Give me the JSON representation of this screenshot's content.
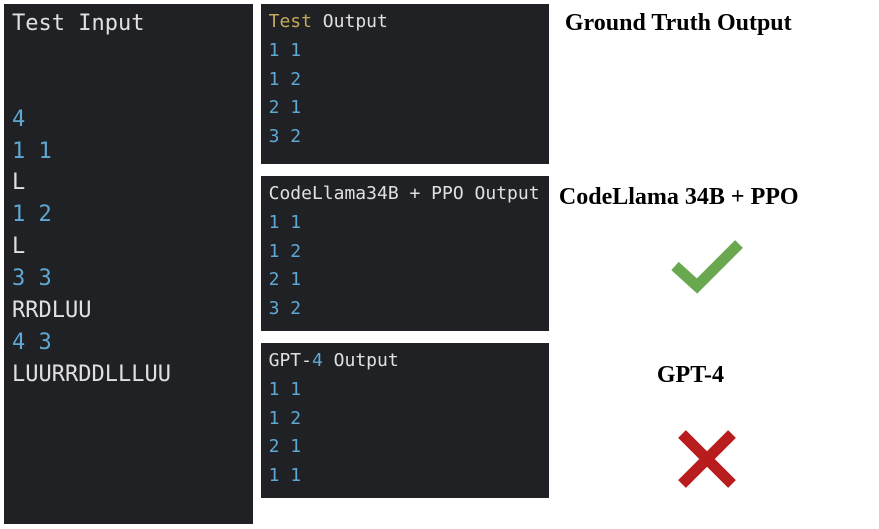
{
  "left_panel": {
    "title_parts": [
      {
        "text": "Test",
        "cls": "t-white"
      },
      {
        "text": " Input",
        "cls": "t-white"
      }
    ],
    "lines": [
      [
        {
          "text": "",
          "cls": "t-white"
        }
      ],
      [
        {
          "text": "",
          "cls": "t-white"
        }
      ],
      [
        {
          "text": "4",
          "cls": "t-cyan"
        }
      ],
      [
        {
          "text": "1 1",
          "cls": "t-cyan"
        }
      ],
      [
        {
          "text": "L",
          "cls": "t-white"
        }
      ],
      [
        {
          "text": "1 2",
          "cls": "t-cyan"
        }
      ],
      [
        {
          "text": "L",
          "cls": "t-white"
        }
      ],
      [
        {
          "text": "3 3",
          "cls": "t-cyan"
        }
      ],
      [
        {
          "text": "RRDLUU",
          "cls": "t-white"
        }
      ],
      [
        {
          "text": "4 3",
          "cls": "t-cyan"
        }
      ],
      [
        {
          "text": "LUURRDDLLLUU",
          "cls": "t-white"
        }
      ]
    ]
  },
  "ground_truth": {
    "header_parts": [
      {
        "text": "Test",
        "cls": "t-yellow"
      },
      {
        "text": " Output",
        "cls": "t-white"
      }
    ],
    "lines": [
      [
        {
          "text": "1 1",
          "cls": "t-cyan"
        }
      ],
      [
        {
          "text": "1 2",
          "cls": "t-cyan"
        }
      ],
      [
        {
          "text": "2 1",
          "cls": "t-cyan"
        }
      ],
      [
        {
          "text": "3 2",
          "cls": "t-cyan"
        }
      ]
    ]
  },
  "codellama": {
    "header_parts": [
      {
        "text": "CodeLlama34B ",
        "cls": "t-white"
      },
      {
        "text": "+",
        "cls": "t-white"
      },
      {
        "text": " PPO Output",
        "cls": "t-white"
      }
    ],
    "lines": [
      [
        {
          "text": "1 1",
          "cls": "t-cyan"
        }
      ],
      [
        {
          "text": "1 2",
          "cls": "t-cyan"
        }
      ],
      [
        {
          "text": "2 1",
          "cls": "t-cyan"
        }
      ],
      [
        {
          "text": "3 2",
          "cls": "t-cyan"
        }
      ]
    ]
  },
  "gpt4": {
    "header_parts": [
      {
        "text": "GPT",
        "cls": "t-white"
      },
      {
        "text": "-",
        "cls": "t-white"
      },
      {
        "text": "4",
        "cls": "t-cyan"
      },
      {
        "text": " Output",
        "cls": "t-white"
      }
    ],
    "lines": [
      [
        {
          "text": "1 1",
          "cls": "t-cyan"
        }
      ],
      [
        {
          "text": "1 2",
          "cls": "t-cyan"
        }
      ],
      [
        {
          "text": "2 1",
          "cls": "t-cyan"
        }
      ],
      [
        {
          "text": "1 1",
          "cls": "t-cyan"
        }
      ]
    ]
  },
  "labels": {
    "ground_truth": "Ground Truth Output",
    "codellama": "CodeLlama 34B + PPO",
    "gpt4": "GPT-4"
  },
  "colors": {
    "check": "#6aa84f",
    "cross": "#b91c1c"
  }
}
